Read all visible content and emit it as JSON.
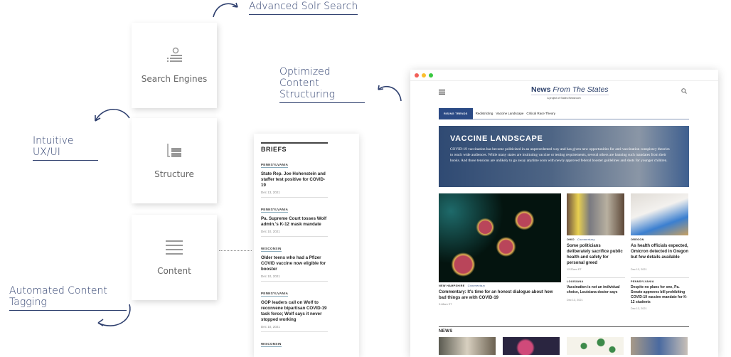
{
  "labels": {
    "solr": "Advanced Solr Search",
    "structuring": "Optimized Content Structuring",
    "ux": "Intuitive UX/UI",
    "tagging": "Automated Content Tagging"
  },
  "cards": [
    {
      "label": "Search Engines",
      "icon": "search-list-icon"
    },
    {
      "label": "Structure",
      "icon": "structure-icon"
    },
    {
      "label": "Content",
      "icon": "lines-icon"
    }
  ],
  "briefs": {
    "title": "BRIEFS",
    "items": [
      {
        "state": "PENNSYLVANIA",
        "headline": "State Rep. Joe Hohenstein and staffer test positive for COVID-19",
        "date": "Dec 13, 2021"
      },
      {
        "state": "PENNSYLVANIA",
        "headline": "Pa. Supreme Court tosses Wolf admin.'s K-12 mask mandate",
        "date": "Dec 10, 2021"
      },
      {
        "state": "WISCONSIN",
        "headline": "Older teens who had a Pfizer COVID vaccine now eligible for booster",
        "date": "Dec 10, 2021"
      },
      {
        "state": "PENNSYLVANIA",
        "headline": "GOP leaders call on Wolf to reconvene bipartisan COVID-19 task force; Wolf says it never stopped working",
        "date": "Dec 10, 2021"
      },
      {
        "state": "WISCONSIN",
        "headline": "",
        "date": ""
      }
    ]
  },
  "site": {
    "logo_bold": "News",
    "logo_italic": "From The States",
    "tagline": "A project of States Newsroom",
    "trends_label": "RISING TRENDS",
    "trends": [
      "Redistricting",
      "Vaccine Landscape",
      "Critical Race Theory"
    ],
    "hero": {
      "title": "VACCINE LANDSCAPE",
      "text": "COVID-19 vaccination has become politicized in an unprecedented way and has given new opportunities for anti-vaccination conspiracy theories to reach wide audiences. While many states are instituting vaccine or testing requirements, several others are banning such mandates from their books. And those tensions are unlikely to go away anytime soon with newly approved federal booster guidelines and shots for younger children."
    },
    "main": {
      "state": "NEW HAMPSHIRE",
      "type": "Commentary",
      "headline": "Commentary: It's time for an honest dialogue about how bad things are with COVID-19",
      "date": "3:48am ET"
    },
    "s1": {
      "state": "OHIO",
      "type": "Commentary",
      "headline": "Some politicians deliberately sacrifice public health and safety for personal greed",
      "date": "12:20am ET"
    },
    "s2": {
      "state": "OREGON",
      "headline": "As health officials expected, Omicron detected in Oregon but few details available",
      "date": "Dec 13, 2021"
    },
    "s3": {
      "state": "LOUISIANA",
      "headline": "Vaccination is not an individual choice, Louisiana doctor says",
      "date": "Dec 13, 2021"
    },
    "s4": {
      "state": "PENNSYLVANIA",
      "headline": "Despite no plans for one, Pa. Senate approves bill prohibiting COVID-19 vaccine mandate for K-12 students",
      "date": "Dec 13, 2021"
    },
    "news_label": "NEWS"
  },
  "colors": {
    "accent": "#2e3f6e",
    "brand": "#2b4a85"
  }
}
